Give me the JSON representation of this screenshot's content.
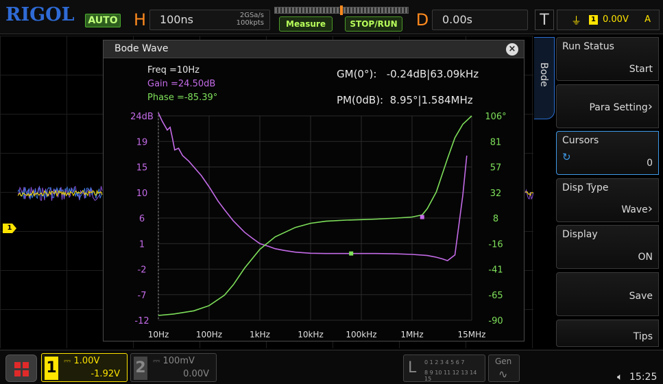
{
  "header": {
    "brand": "RIGOL",
    "trigger_mode": "AUTO",
    "horizontal_letter": "H",
    "timebase": "100ns",
    "sample_rate": "2GSa/s",
    "memory_depth": "100kpts",
    "measure_label": "Measure",
    "stop_run_label": "STOP/RUN",
    "delay_letter": "D",
    "delay_value": "0.00s",
    "trigger_letter": "T",
    "trigger_source": "1",
    "trigger_level": "0.00V",
    "trigger_coupling": "A"
  },
  "bode": {
    "title": "Bode Wave",
    "freq_label": "Freq =10Hz",
    "gain_label": "Gain =24.50dB",
    "phase_label": "Phase =-85.39°",
    "gm_label": "GM(0°):",
    "gm_value": "-0.24dB|63.09kHz",
    "pm_label": "PM(0dB):",
    "pm_value": "8.95°|1.584MHz",
    "tab_label": "Bode"
  },
  "chart_data": {
    "type": "line",
    "xscale": "log",
    "xlim": [
      10,
      15000000
    ],
    "x_ticks": [
      {
        "v": 10,
        "label": "10Hz"
      },
      {
        "v": 100,
        "label": "100Hz"
      },
      {
        "v": 1000,
        "label": "1kHz"
      },
      {
        "v": 10000,
        "label": "10kHz"
      },
      {
        "v": 100000,
        "label": "100kHz"
      },
      {
        "v": 1000000,
        "label": "1MHz"
      },
      {
        "v": 15000000,
        "label": "15MHz"
      }
    ],
    "gain_axis": {
      "ylim": [
        -12,
        24
      ],
      "ticks": [
        "24dB",
        "19",
        "15",
        "10",
        "6",
        "1",
        "-2",
        "-7",
        "-12"
      ]
    },
    "phase_axis": {
      "ylim": [
        -90,
        106
      ],
      "ticks": [
        "106°",
        "81",
        "57",
        "32",
        "8",
        "-16",
        "-41",
        "-65",
        "-90"
      ]
    },
    "series": [
      {
        "color": "#c46be8",
        "axis": "gain",
        "x": [
          10,
          12,
          15,
          17,
          19,
          21,
          25,
          30,
          40,
          50,
          70,
          100,
          150,
          200,
          300,
          500,
          700,
          1000,
          1500,
          2000,
          3000,
          5000,
          10000,
          20000,
          50000,
          100000,
          200000,
          500000,
          1000000,
          2000000,
          3000000,
          4000000,
          5000000,
          7000000,
          10000000,
          12000000
        ],
        "y": [
          24.5,
          23,
          21.5,
          22,
          20,
          18,
          18.3,
          17,
          16,
          15,
          13.5,
          11.5,
          9,
          7.5,
          5.5,
          3.5,
          2.5,
          1.5,
          1,
          0.6,
          0.3,
          0,
          -0.2,
          -0.25,
          -0.25,
          -0.25,
          -0.25,
          -0.3,
          -0.4,
          -0.6,
          -0.9,
          -1.2,
          -1.5,
          -0.5,
          10,
          17
        ]
      },
      {
        "color": "#7ee05a",
        "axis": "phase",
        "x": [
          10,
          20,
          50,
          100,
          200,
          300,
          500,
          1000,
          2000,
          5000,
          10000,
          20000,
          50000,
          100000,
          200000,
          500000,
          1000000,
          1584000,
          2000000,
          3000000,
          5000000,
          7000000,
          10000000,
          15000000
        ],
        "y": [
          -85.4,
          -84,
          -81,
          -76,
          -66,
          -56,
          -40,
          -22,
          -10,
          -1,
          3,
          5,
          6,
          6.5,
          7,
          8,
          9,
          11,
          17,
          33,
          65,
          85,
          98,
          106
        ]
      }
    ],
    "markers": [
      {
        "x": 63090,
        "y": -0.24,
        "axis": "gain",
        "color": "#7ee05a"
      },
      {
        "x": 1584000,
        "y": 8.95,
        "axis": "phase",
        "color": "#c46be8"
      }
    ]
  },
  "menu": [
    {
      "label": "Run Status",
      "value": "Start"
    },
    {
      "label": "Para Setting",
      "value": "",
      "arrow": "›"
    },
    {
      "label": "Cursors",
      "value": "0",
      "knob": "↻"
    },
    {
      "label": "Disp Type",
      "value": "Wave",
      "arrow": "›"
    },
    {
      "label": "Display",
      "value": "ON"
    },
    {
      "label": "Save",
      "value": ""
    },
    {
      "label": "Tips",
      "value": ""
    }
  ],
  "footer": {
    "ch1_num": "1",
    "ch1_scale": "1.00V",
    "ch1_offset": "-1.92V",
    "ch2_num": "2",
    "ch2_scale": "100mV",
    "ch2_offset": "0.00V",
    "la_letter": "L",
    "la_row1": "0 1 2 3  4 5 6 7",
    "la_row2": "8 9 10 11 12 13 14 15",
    "gen_label": "Gen",
    "clock": "15:25"
  },
  "colors": {
    "ch1": "#ffe400",
    "ch2": "#555555",
    "accent_blue": "#3f9ae8",
    "gain": "#c46be8",
    "phase": "#7ee05a"
  }
}
